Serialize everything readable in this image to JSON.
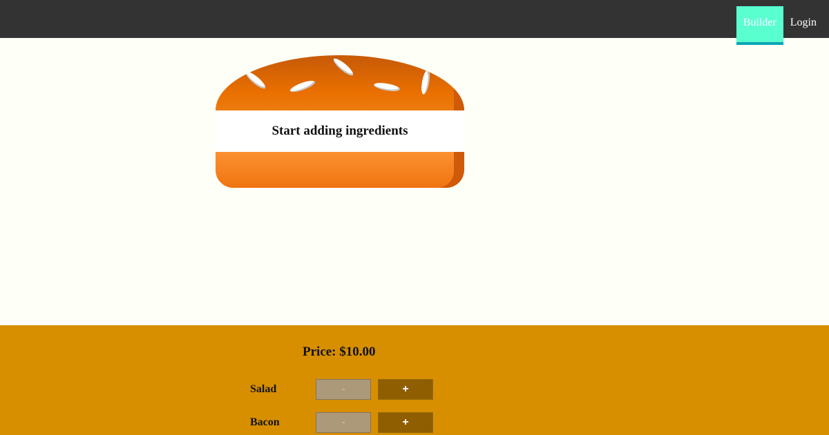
{
  "nav": {
    "items": [
      {
        "label": "Builder",
        "active": true
      },
      {
        "label": "Login",
        "active": false
      }
    ]
  },
  "burger": {
    "empty_message": "Start adding ingredients"
  },
  "controls": {
    "price": "Price: $10.00",
    "ingredients": [
      {
        "label": "Salad",
        "less": "-",
        "more": "+"
      },
      {
        "label": "Bacon",
        "less": "-",
        "more": "+"
      }
    ]
  },
  "colors": {
    "toolbar": "#333333",
    "active_nav": "#5affd0",
    "controls_bg": "#d78f00",
    "more_button": "#8f5e00",
    "less_button": "#ac9979"
  }
}
